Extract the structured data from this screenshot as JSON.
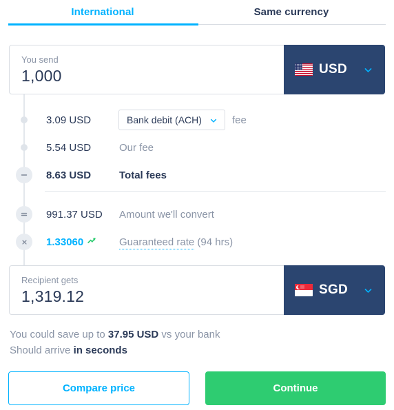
{
  "tabs": [
    {
      "label": "International",
      "active": true
    },
    {
      "label": "Same currency",
      "active": false
    }
  ],
  "send": {
    "label": "You send",
    "value": "1,000",
    "currency": "USD",
    "flag": "us-flag-icon",
    "chevron": "chevron-down-icon"
  },
  "receive": {
    "label": "Recipient gets",
    "value": "1,319.12",
    "currency": "SGD",
    "flag": "sg-flag-icon",
    "chevron": "chevron-down-icon"
  },
  "breakdown": {
    "payin_fee": {
      "value": "3.09 USD",
      "method": "Bank debit (ACH)",
      "suffix": "fee",
      "node": "dot"
    },
    "our_fee": {
      "value": "5.54 USD",
      "label": "Our fee",
      "node": "dot"
    },
    "total_fees": {
      "value": "8.63 USD",
      "label": "Total fees",
      "node": "minus"
    },
    "convert": {
      "value": "991.37 USD",
      "label": "Amount we'll convert",
      "node": "equals"
    },
    "rate": {
      "value": "1.33060",
      "trend_icon": "trending-up-icon",
      "label": "Guaranteed rate",
      "duration": "(94 hrs)",
      "node": "multiply"
    }
  },
  "savings": {
    "line1_prefix": "You could save up to ",
    "line1_amount": "37.95 USD",
    "line1_suffix": " vs your bank",
    "line2_prefix": "Should arrive ",
    "line2_bold": "in seconds"
  },
  "actions": {
    "compare": "Compare price",
    "continue": "Continue"
  },
  "colors": {
    "accent_blue": "#00b2ff",
    "navy": "#2b4570",
    "green": "#2ecc71",
    "trend_green": "#2ecc71",
    "muted": "#8a94a6"
  }
}
